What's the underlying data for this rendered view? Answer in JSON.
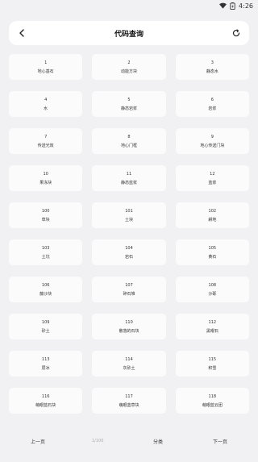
{
  "status_bar": {
    "time": "4:26"
  },
  "header": {
    "title": "代码查询"
  },
  "items": [
    {
      "code": "1",
      "name": "地心基石"
    },
    {
      "code": "2",
      "name": "动能方块"
    },
    {
      "code": "3",
      "name": "静态水"
    },
    {
      "code": "4",
      "name": "水"
    },
    {
      "code": "5",
      "name": "静态岩浆"
    },
    {
      "code": "6",
      "name": "岩浆"
    },
    {
      "code": "7",
      "name": "传送光效"
    },
    {
      "code": "8",
      "name": "地心门框"
    },
    {
      "code": "9",
      "name": "地心传送门块"
    },
    {
      "code": "10",
      "name": "果冻块"
    },
    {
      "code": "11",
      "name": "静态蓝浆"
    },
    {
      "code": "12",
      "name": "蓝浆"
    },
    {
      "code": "100",
      "name": "草块"
    },
    {
      "code": "101",
      "name": "土块"
    },
    {
      "code": "102",
      "name": "耕地"
    },
    {
      "code": "103",
      "name": "土坑"
    },
    {
      "code": "104",
      "name": "岩石"
    },
    {
      "code": "105",
      "name": "黄石"
    },
    {
      "code": "106",
      "name": "藤沙块"
    },
    {
      "code": "107",
      "name": "碎石堆"
    },
    {
      "code": "108",
      "name": "沙砾"
    },
    {
      "code": "109",
      "name": "砂土"
    },
    {
      "code": "110",
      "name": "散落的石块"
    },
    {
      "code": "112",
      "name": "黑曜石"
    },
    {
      "code": "113",
      "name": "层冰"
    },
    {
      "code": "114",
      "name": "灰砂土"
    },
    {
      "code": "115",
      "name": "积雪"
    },
    {
      "code": "116",
      "name": "萌眼蓝石块"
    },
    {
      "code": "117",
      "name": "萌眼蓝草块"
    },
    {
      "code": "118",
      "name": "萌眼蓝云团"
    }
  ],
  "pager": {
    "prev_label": "上一页",
    "page_indicator": "1/100",
    "category_label": "分类",
    "next_label": "下一页"
  }
}
